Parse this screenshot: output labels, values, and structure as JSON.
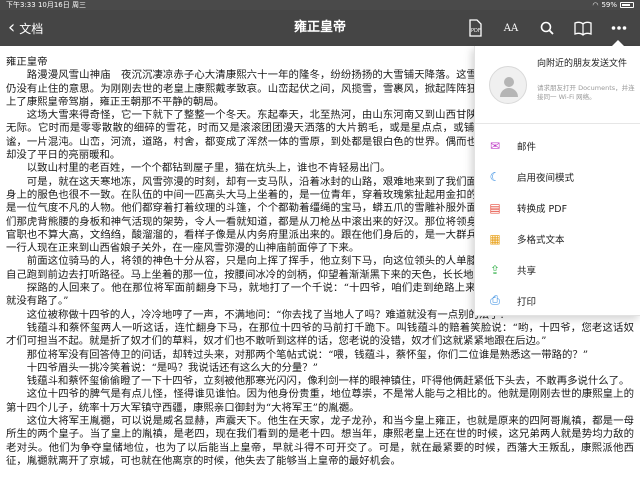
{
  "status_bar": {
    "time_date": "下午3:33   10月16日 周三",
    "battery": "59%"
  },
  "nav": {
    "back_label": "文档",
    "title": "雍正皇帝",
    "icons": [
      "pdf-icon",
      "font-size-icon",
      "search-icon",
      "book-icon",
      "more-icon"
    ],
    "font_icon_text": "AA",
    "pdf_icon_text": "PDF"
  },
  "content": {
    "chapter_title": "雍正皇帝",
    "paragraphs": [
      "路漫漫风雪山神庙　夜沉沉凄凉赤子心大清康熙六十一年的隆冬，纷纷扬扬的大雪铺天降落。这雪，纷纷扬扬的，一直下到了过年，仍没有止住的意思。为刚刚去世的老皇上康熙戴孝致哀。山峦起伏之间，风揽雪，雪裹风，掀起阵阵狂飚。这骤然而来的暴风雪，刚好凑上了康熙皇帝驾崩，雍正王朝那不平静的朝局。",
      "这场大雪来得奇怪，它一下就下了整整一个冬天。东起奉天，北至热河，由山东河南又到山西甘陕各地，尽都是一片银装素裹，苍茫无际。它时而是零零散散的细碎的雪花，时而又是滚滚团团漫天洒落的大片鹅毛，或是星点点，或铺天盖地，只下得玉宇澄清，寰宇静谧，一片混沌。山峦，河流，道路，村舍，都变成了浑然一体的雪原，到处都是银白色的世界。偶而也会有一阵放晴，苍白的一丝温柔，却没了平日的亮丽暖和。",
      "以致山村里的老百姓，一个个都钻到屋子里，猫在炕头上，谁也不肯轻易出门。",
      "可是，就在这天寒地冻，风雪弥漫的时刻，却有一支马队，沿着冰封的山路，艰难地来到了我们面前。这一小队骑兵来得特别，他们身上的服色也很不一致。在队伍的中间一匹高头大马上坐着的，是一位青年，穿着玫瑰紫扯起用金扣的蜡彩，也透着几分英俊和精明。这是一位气度不凡的人物。他们都穿着打着纹理的斗篷，个个都勒着缰绳的宝马，蟒五爪的雪雕补服外面，还披着白狐风毛的羔皮大氅。他们那虎背熊腰的身板和神气活现的架势，令人一看就知道，都是从刀枪丛中滚出来的好汉。那位将领身边的，是两个文官打扮的人。大概官职也不算大高，文绉绉，酸溜溜的，看样子像是从内务府里派出来的。跟在他们身后的，是一大群兵丁，约摸有二十来个人的样子。这一行人现在正来到山西省娘子关外，在一座风雪弥漫的山神庙前面停了下来。",
      "前面这位骑马的人，将领的神色十分从容，只是向上挥了挥手，他立刻下马，向这位领头的人单膝跪下，他连忙招呼队伍停了下来，自己跑到前边去打听路径。马上坐着的那一位，按腰间冰冷的剑柄，仰望着渐渐黑下来的天色，长长地出了一口气。",
      "探路的人回来了。他在那位将军面前翻身下马，就地打了一个千说：“十四爷，咱们走到绝路上来了。前面是一片冰封的冻河，根本就没有路了。”",
      "这位被称做十四爷的人，冷冷地哼了一声，不满地问：“你去找了当地人了吗？难道就没有一点别的法子？”",
      "钱蕴斗和蔡怀玺两人一听这话，连忙翻身下马，在那位十四爷的马前打千跪下。叫钱蕴斗的赔着笑脸说：“哟，十四爷，您老这话奴才们可担当不起。就是折了奴才们的草料，奴才们也不敢听到这样的话，您老说的没错，奴才们这就紧紧地跟在后边。”",
      "那位将军没有回答侍卫的问话，却转过头来，对那两个笔帖式说：“喂，钱蕴斗，蔡怀玺，你们二位谁是熟悉这一带路的？”",
      "十四爷眉头一挑冷笑着说：“是吗？我说话还有这么大的分量？”",
      "钱蕴斗和蔡怀玺偷偷瞪了一下十四爷，立刻被他那寒光闪闪，像利剑一样的眼神镇住，吓得他俩赶紧低下头去，不敢再多说什么了。",
      "这位十四爷的脾气是有点儿怪，怪得谁见谁怕。因为他身份贵重，地位尊崇，不是常人能与之相比的。他就是刚刚去世的康熙皇上的第十四个儿子，统率十万大军镇守西疆，康熙亲口御封为“大将军王”的胤禵。",
      "这位大将军王胤禵，可以说是威名显赫，声震天下。他生在天家，龙子龙孙，和当今皇上雍正，也就是原来的四阿哥胤禛，都是一母所生的两个皇子。当了皇上的胤禛，是老四，现在我们看到的是老十四。想当年，康熙老皇上还在世的时候，这兄弟两人就是势均力敌的老对头。他们为争夺皇储地位，也为了以后能当上皇帝，早就斗得不可开交了。可是，就在最紧要的时候，西藩大王叛乱，康熙派他西征，胤禵就离开了京城，可也就在他离京的时候，他失去了能够当上皇帝的最好机会。"
    ]
  },
  "menu": {
    "airdrop_title": "向附近的朋友发送文件",
    "airdrop_sub": "请求朋友打开 Documents，并连接同一 Wi-Fi 网络。",
    "items": [
      {
        "label": "邮件",
        "icon": "mail-icon",
        "glyph": "✉",
        "color": "#c040c8"
      },
      {
        "label": "启用夜间模式",
        "icon": "moon-icon",
        "glyph": "☾",
        "color": "#2f88e0"
      },
      {
        "label": "转换成 PDF",
        "icon": "convert-pdf-icon",
        "glyph": "▤",
        "color": "#e5493a"
      },
      {
        "label": "多格式文本",
        "icon": "rich-text-icon",
        "glyph": "▦",
        "color": "#e8a21e"
      },
      {
        "label": "共享",
        "icon": "share-icon",
        "glyph": "⇪",
        "color": "#37b24d"
      },
      {
        "label": "打印",
        "icon": "print-icon",
        "glyph": "⎙",
        "color": "#2f88e0"
      }
    ]
  }
}
